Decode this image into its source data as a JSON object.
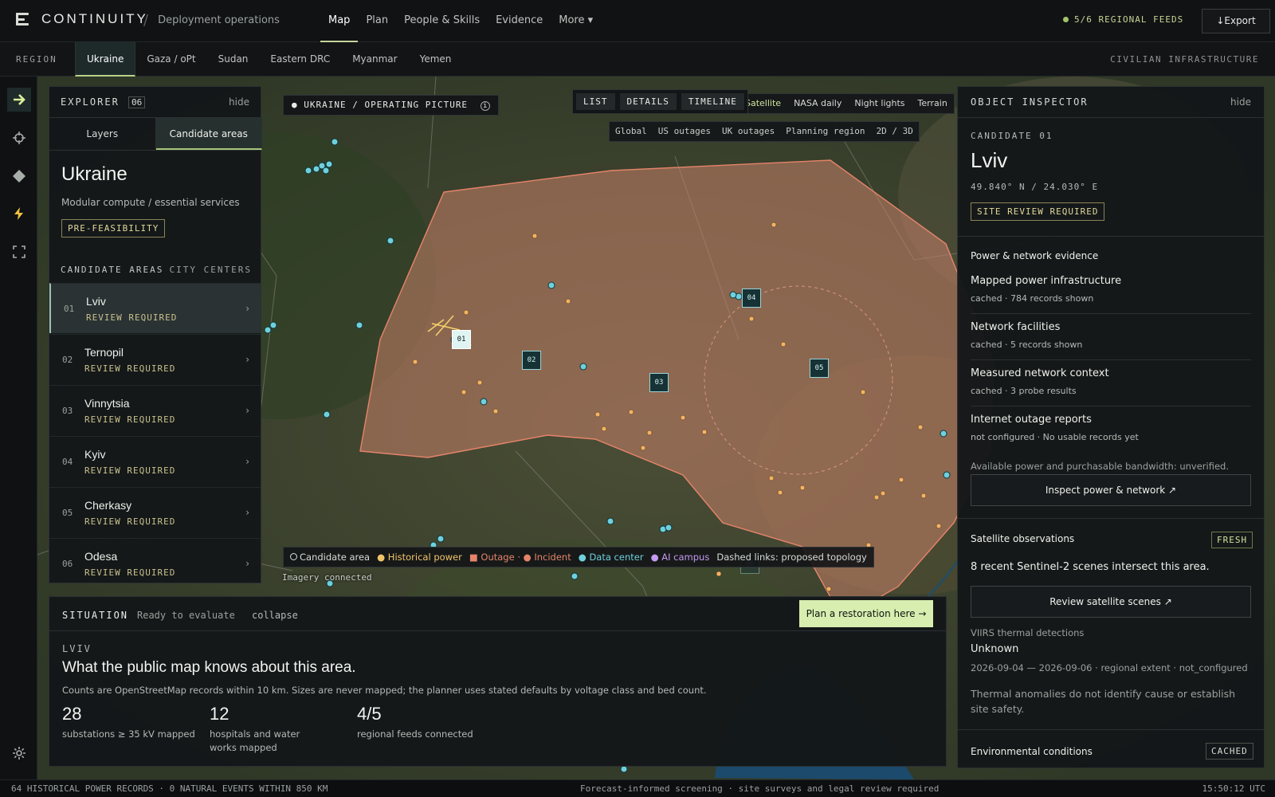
{
  "app": {
    "name": "CONTINUITY",
    "breadcrumb": "Deployment operations"
  },
  "nav": [
    {
      "label": "Map",
      "active": true
    },
    {
      "label": "Plan"
    },
    {
      "label": "People & Skills"
    },
    {
      "label": "Evidence"
    },
    {
      "label": "More ▾"
    }
  ],
  "feeds": "5/6 REGIONAL FEEDS",
  "export_label": "↓Export",
  "region": {
    "label": "REGION",
    "tabs": [
      "Ukraine",
      "Gaza / oPt",
      "Sudan",
      "Eastern DRC",
      "Myanmar",
      "Yemen"
    ],
    "active": "Ukraine",
    "right_label": "CIVILIAN INFRASTRUCTURE"
  },
  "rail_icons": [
    "arrow-right-icon",
    "crosshair-icon",
    "diamond-icon",
    "bolt-icon",
    "expand-icon",
    "gear-icon"
  ],
  "explorer": {
    "title": "EXPLORER",
    "count": "06",
    "hide": "hide",
    "tabs": [
      "Layers",
      "Candidate areas"
    ],
    "region_title": "Ukraine",
    "subtitle": "Modular compute / essential services",
    "badge": "PRE-FEASIBILITY",
    "list_header": "CANDIDATE AREAS",
    "list_toggle": "CITY CENTERS",
    "candidates": [
      {
        "num": "01",
        "name": "Lviv",
        "status": "REVIEW REQUIRED"
      },
      {
        "num": "02",
        "name": "Ternopil",
        "status": "REVIEW REQUIRED"
      },
      {
        "num": "03",
        "name": "Vinnytsia",
        "status": "REVIEW REQUIRED"
      },
      {
        "num": "04",
        "name": "Kyiv",
        "status": "REVIEW REQUIRED"
      },
      {
        "num": "05",
        "name": "Cherkasy",
        "status": "REVIEW REQUIRED"
      },
      {
        "num": "06",
        "name": "Odesa",
        "status": "REVIEW REQUIRED"
      }
    ]
  },
  "map": {
    "operating_picture": "UKRAINE / OPERATING PICTURE",
    "view_tabs": [
      "LIST",
      "DETAILS",
      "TIMELINE"
    ],
    "basemaps": [
      "Satellite",
      "NASA daily",
      "Night lights",
      "Terrain"
    ],
    "active_basemap": "Satellite",
    "scopes": [
      "Global",
      "US outages",
      "UK outages",
      "Planning region",
      "2D / 3D"
    ],
    "legend": [
      "Candidate area",
      "Historical power",
      "Outage",
      "Incident",
      "Data center",
      "AI campus",
      "Dashed links: proposed topology"
    ],
    "imagery": "Imagery connected",
    "markers": [
      "01",
      "02",
      "03",
      "04",
      "05",
      "06"
    ]
  },
  "inspector": {
    "title": "OBJECT INSPECTOR",
    "hide": "hide",
    "candidate": "CANDIDATE 01",
    "name": "Lviv",
    "coords": "49.840° N / 24.030° E",
    "badge": "SITE REVIEW REQUIRED",
    "power_section": "Power & network evidence",
    "evidence": [
      {
        "title": "Mapped power infrastructure",
        "sub": "cached · 784 records shown"
      },
      {
        "title": "Network facilities",
        "sub": "cached · 5 records shown"
      },
      {
        "title": "Measured network context",
        "sub": "cached · 3 probe results"
      },
      {
        "title": "Internet outage reports",
        "sub": "not configured · No usable records yet"
      }
    ],
    "bandwidth_note": "Available power and purchasable bandwidth: unverified.",
    "inspect_btn": "Inspect power & network ↗",
    "sat_title": "Satellite observations",
    "sat_tag": "FRESH",
    "sat_text": "8 recent Sentinel-2 scenes intersect this area.",
    "sat_btn": "Review satellite scenes ↗",
    "viirs_label": "VIIRS thermal detections",
    "viirs_value": "Unknown",
    "viirs_range": "2026-09-04 — 2026-09-06 · regional extent · not_configured",
    "thermal_note": "Thermal anomalies do not identify cause or establish site safety.",
    "env_title": "Environmental conditions",
    "env_tag": "CACHED"
  },
  "situation": {
    "title": "SITUATION",
    "status": "Ready to evaluate",
    "collapse": "collapse",
    "plan_btn": "Plan a restoration here →",
    "location": "LVIV",
    "heading": "What the public map knows about this area.",
    "desc": "Counts are OpenStreetMap records within 10 km. Sizes are never mapped; the planner uses stated defaults by voltage class and bed count.",
    "stats": [
      {
        "value": "28",
        "label": "substations ≥ 35 kV mapped"
      },
      {
        "value": "12",
        "label": "hospitals and water works mapped"
      },
      {
        "value": "4/5",
        "label": "regional feeds connected"
      }
    ]
  },
  "statusbar": {
    "left": "64 HISTORICAL POWER RECORDS · 0 NATURAL EVENTS WITHIN 850 KM",
    "center": "Forecast-informed screening · site surveys and legal review required",
    "time": "15:50:12 UTC"
  },
  "colors": {
    "accent": "#c7d59c",
    "candidate_fill": "#c8826a",
    "datacenter": "#6fd0dc",
    "historical_power": "#f0b060"
  }
}
